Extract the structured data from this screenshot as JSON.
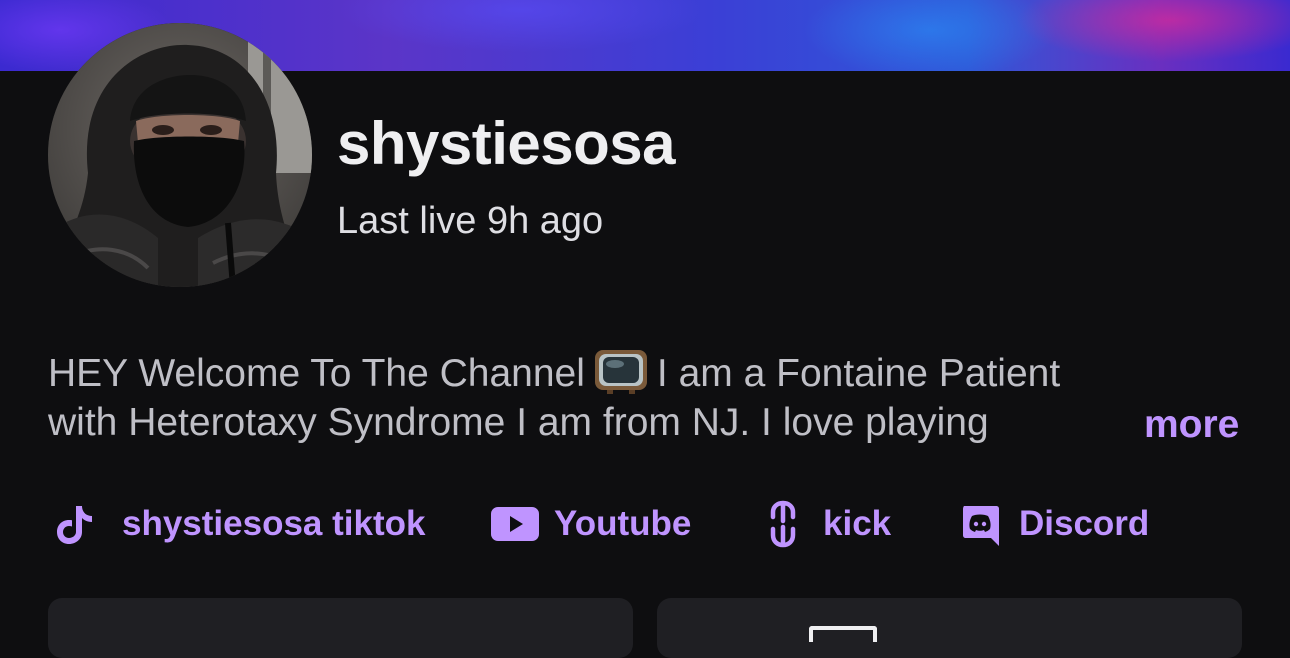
{
  "channel": {
    "username": "shystiesosa",
    "last_live": "Last live 9h ago"
  },
  "bio": {
    "line1_a": "HEY Welcome To The Channel",
    "line1_b": "I am a Fontaine Patient",
    "line2": "with Heterotaxy Syndrome I am from NJ. I love playing",
    "more_label": "more"
  },
  "social_links": [
    {
      "label": "shystiesosa tiktok",
      "icon": "tiktok-icon"
    },
    {
      "label": "Youtube",
      "icon": "youtube-icon"
    },
    {
      "label": "kick",
      "icon": "link-icon"
    },
    {
      "label": "Discord",
      "icon": "discord-icon"
    }
  ],
  "colors": {
    "background": "#0e0e10",
    "accent": "#bf94ff",
    "text_primary": "#efeff1",
    "text_secondary": "#bfbfc6",
    "card": "#1f1f23"
  }
}
